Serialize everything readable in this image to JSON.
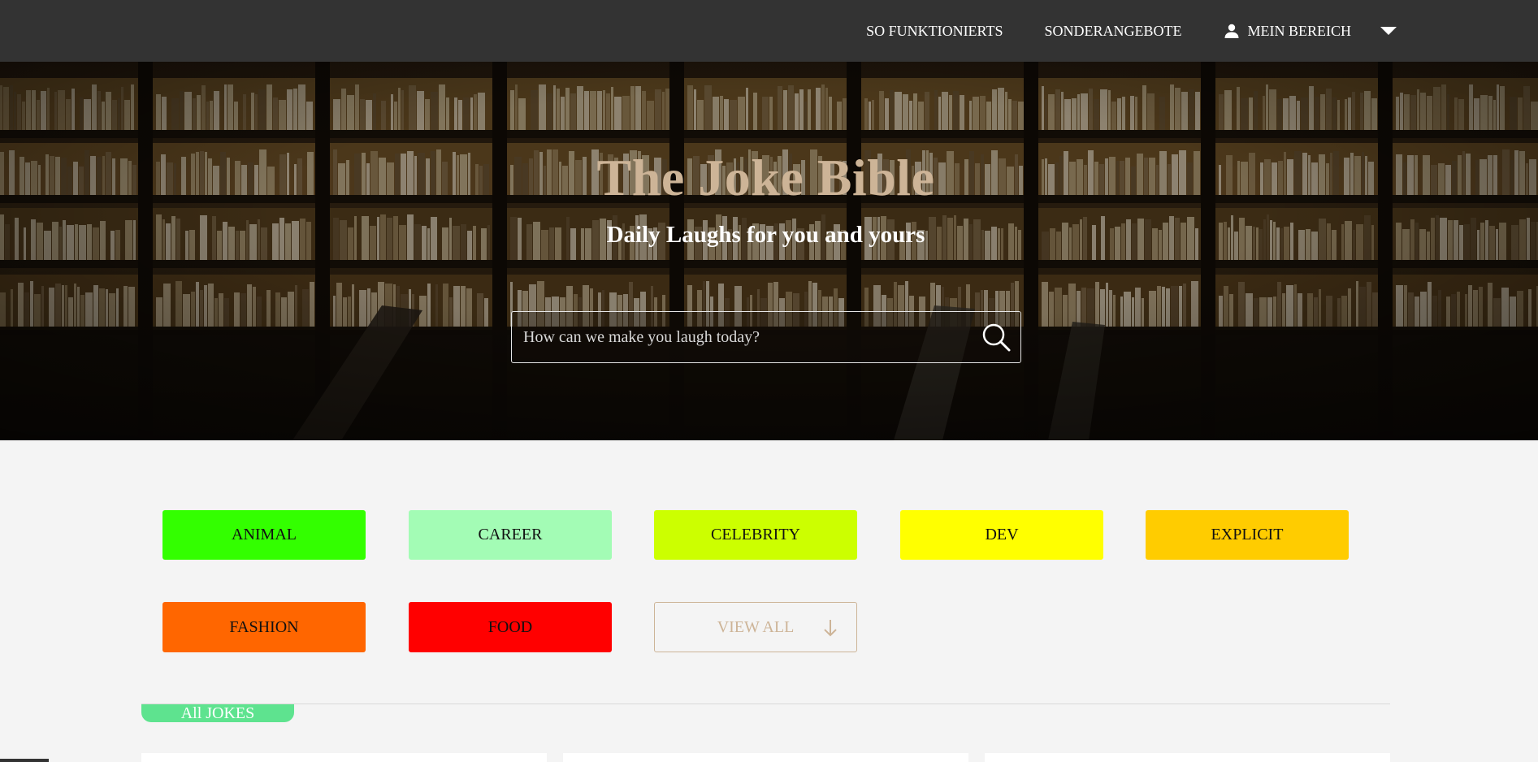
{
  "nav": {
    "links": [
      {
        "label": "SO FUNKTIONIERTS"
      },
      {
        "label": "SONDERANGEBOTE"
      },
      {
        "label": "MEIN BEREICH",
        "icon": "user-icon"
      }
    ],
    "dropdown_icon": "caret-down-icon"
  },
  "hero": {
    "title": "The Joke Bible",
    "subtitle": "Daily Laughs for you and yours",
    "search": {
      "placeholder": "How can we make you laugh today?",
      "value": "",
      "icon": "search-icon"
    }
  },
  "categories": [
    {
      "label": "ANIMAL",
      "color": "#33ff00"
    },
    {
      "label": "CAREER",
      "color": "#a3fcb5"
    },
    {
      "label": "CELEBRITY",
      "color": "#ccff00"
    },
    {
      "label": "DEV",
      "color": "#ffff00"
    },
    {
      "label": "EXPLICIT",
      "color": "#ffcc00"
    },
    {
      "label": "FASHION",
      "color": "#ff6600"
    },
    {
      "label": "FOOD",
      "color": "#ff0000"
    }
  ],
  "view_all": {
    "label": "VIEW ALL",
    "icon": "arrow-down-icon",
    "color": "#cdb497"
  },
  "section": {
    "label": "All JOKES",
    "color": "#5ee38f"
  },
  "colors": {
    "nav_bg": "#333333",
    "page_bg": "#f4f4f4",
    "title_gold": "#cdb497"
  }
}
